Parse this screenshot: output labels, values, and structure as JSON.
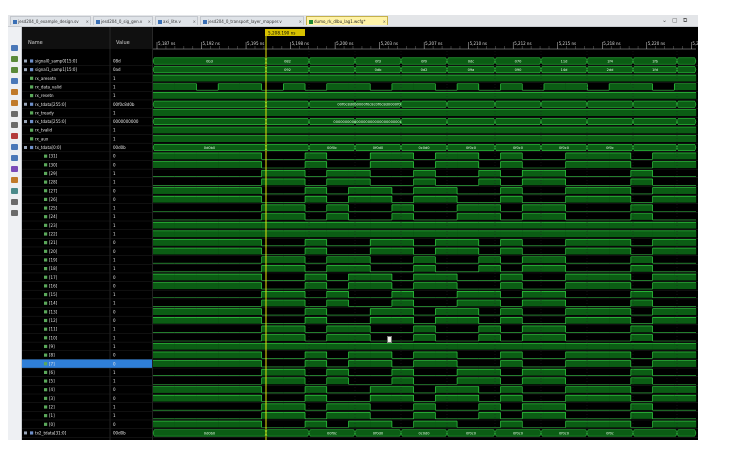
{
  "tabs": [
    {
      "label": "jesd204_0_example_design.sv"
    },
    {
      "label": "jesd204_0_sig_gen.v"
    },
    {
      "label": "axi_lite.v"
    },
    {
      "label": "jesd204_0_transport_layer_mapper.v"
    },
    {
      "label": "dumo_rk_dlbu_lag1.wcfg*",
      "active": true
    }
  ],
  "window_controls": {
    "menu": "⌄",
    "restore": "▢",
    "maximize": "⧉"
  },
  "columns": {
    "name": "Name",
    "value": "Value"
  },
  "cursor": {
    "label": "5,208.190 ns"
  },
  "timeline": {
    "ticks": [
      "5,187 ns",
      "5,192 ns",
      "5,195 ns",
      "5,198 ns",
      "5,200 ns",
      "5,203 ns",
      "5,207 ns",
      "5,210 ns",
      "5,212 ns",
      "5,215 ns",
      "5,218 ns",
      "5,220 ns",
      "5,222 ns"
    ]
  },
  "signals": [
    {
      "name": "signal0_samp0[15:0]",
      "value": "08d",
      "type": "bus",
      "segments": [
        "0b3",
        "082",
        "",
        "0f3",
        "0f0",
        "0dc",
        "070",
        "11d",
        "1f4",
        "1fb"
      ]
    },
    {
      "name": "signal1_samp1[15:0]",
      "value": "0ad",
      "type": "bus",
      "segments": [
        "",
        "092",
        "",
        "0db",
        "0d2",
        "09a",
        "090",
        "14d",
        "2dd",
        "1fd"
      ]
    },
    {
      "name": "rx_aresetn",
      "value": "1",
      "type": "high"
    },
    {
      "name": "rx_data_valid",
      "value": "1",
      "type": "bits",
      "pattern": "1101101011011010101101101"
    },
    {
      "name": "rx_resetn",
      "value": "1",
      "type": "high"
    },
    {
      "name": "rx_tdata[255:0]",
      "value": "00f0c8d0b",
      "type": "bus",
      "segments": [
        "",
        "",
        "",
        "00f0c8d0b0000f0c8c0f0c8d0000f0c8d0b000"
      ]
    },
    {
      "name": "rx_tready",
      "value": "1",
      "type": "high"
    },
    {
      "name": "rx_tdata[255:0]",
      "value": "0000000000",
      "type": "bus",
      "segments": [
        "",
        "",
        "",
        "000000000000000000000000000000000000000"
      ]
    },
    {
      "name": "rx_tvalid",
      "value": "1",
      "type": "high"
    },
    {
      "name": "rx_aux",
      "value": "1",
      "type": "high"
    },
    {
      "name": "tx_tdata[0:0]",
      "value": "00d0b",
      "type": "bus",
      "segments": [
        "0d0b0",
        "",
        "00f0c",
        "0f0d0",
        "0c0d0",
        "0f0c0",
        "0f0c0",
        "0f0c0",
        "0f0c"
      ]
    },
    {
      "name": "[31]",
      "value": "0",
      "type": "bits",
      "pattern": "1111100100110110100111011"
    },
    {
      "name": "[30]",
      "value": "0",
      "type": "bits",
      "pattern": "1111100100110110100111011"
    },
    {
      "name": "[29]",
      "value": "1",
      "type": "bits",
      "pattern": "0000011011001001011000100"
    },
    {
      "name": "[28]",
      "value": "1",
      "type": "bits",
      "pattern": "0000011011001001011000100"
    },
    {
      "name": "[27]",
      "value": "0",
      "type": "bits",
      "pattern": "1111100101101100100111011"
    },
    {
      "name": "[26]",
      "value": "0",
      "type": "bits",
      "pattern": "1111100101101100100111011"
    },
    {
      "name": "[25]",
      "value": "1",
      "type": "bits",
      "pattern": "0000011010010011011000100"
    },
    {
      "name": "[24]",
      "value": "1",
      "type": "bits",
      "pattern": "0000011010010011011000100"
    },
    {
      "name": "[23]",
      "value": "1",
      "type": "bits",
      "pattern": "1111111111111111111111111"
    },
    {
      "name": "[22]",
      "value": "1",
      "type": "bits",
      "pattern": "1111111111111111111111111"
    },
    {
      "name": "[21]",
      "value": "0",
      "type": "bits",
      "pattern": "1111100100110110100111011"
    },
    {
      "name": "[20]",
      "value": "0",
      "type": "bits",
      "pattern": "1111100100110110100111011"
    },
    {
      "name": "[19]",
      "value": "1",
      "type": "bits",
      "pattern": "0000011011001001011000100"
    },
    {
      "name": "[18]",
      "value": "1",
      "type": "bits",
      "pattern": "0000011011001001011000100"
    },
    {
      "name": "[17]",
      "value": "0",
      "type": "bits",
      "pattern": "1111100101101100100111011"
    },
    {
      "name": "[16]",
      "value": "0",
      "type": "bits",
      "pattern": "1111100101101100100111011"
    },
    {
      "name": "[15]",
      "value": "1",
      "type": "bits",
      "pattern": "0000011010010011011000100"
    },
    {
      "name": "[14]",
      "value": "1",
      "type": "bits",
      "pattern": "0000011010010011011000100"
    },
    {
      "name": "[13]",
      "value": "0",
      "type": "bits",
      "pattern": "1111100100110110100111011"
    },
    {
      "name": "[12]",
      "value": "0",
      "type": "bits",
      "pattern": "1111100100110110100111011"
    },
    {
      "name": "[11]",
      "value": "1",
      "type": "bits",
      "pattern": "0000011011001001011000100"
    },
    {
      "name": "[10]",
      "value": "1",
      "type": "bits",
      "pattern": "0000011011001001011000100"
    },
    {
      "name": "[9]",
      "value": "1",
      "type": "bits",
      "pattern": "1111111111111111111111111"
    },
    {
      "name": "[8]",
      "value": "0",
      "type": "bits",
      "pattern": "1111100101101100100111011"
    },
    {
      "name": "[7]",
      "value": "0",
      "type": "bits",
      "pattern": "1111100101101100100111011",
      "selected": true
    },
    {
      "name": "[6]",
      "value": "1",
      "type": "bits",
      "pattern": "0000011010010011011000100"
    },
    {
      "name": "[5]",
      "value": "1",
      "type": "bits",
      "pattern": "0000011010010011011000100"
    },
    {
      "name": "[4]",
      "value": "0",
      "type": "bits",
      "pattern": "1111100100110110100111011"
    },
    {
      "name": "[3]",
      "value": "0",
      "type": "bits",
      "pattern": "1111100100110110100111011"
    },
    {
      "name": "[2]",
      "value": "1",
      "type": "bits",
      "pattern": "0000011011001001011000100"
    },
    {
      "name": "[1]",
      "value": "1",
      "type": "bits",
      "pattern": "0000011011001001011000100"
    },
    {
      "name": "[0]",
      "value": "0",
      "type": "bits",
      "pattern": "1111100101101100100111011"
    },
    {
      "name": "tx2_tdata[31:0]",
      "value": "00d0b",
      "type": "bus",
      "segments": [
        "0d0b0",
        "",
        "00f0c",
        "0f0d0",
        "0c0d0",
        "0f0c0",
        "0f0c0",
        "0f0c0",
        "0f0c"
      ]
    }
  ],
  "tools": [
    {
      "name": "save-tool",
      "color": "#4a78b8"
    },
    {
      "name": "zoom-in-tool",
      "color": "#5a8a3a"
    },
    {
      "name": "zoom-out-tool",
      "color": "#5a8a3a"
    },
    {
      "name": "zoom-fit-tool",
      "color": "#4a78b8"
    },
    {
      "name": "go-to-start-tool",
      "color": "#c07a2a"
    },
    {
      "name": "go-to-end-tool",
      "color": "#c07a2a"
    },
    {
      "name": "prev-edge-tool",
      "color": "#6a6a6a"
    },
    {
      "name": "next-edge-tool",
      "color": "#6a6a6a"
    },
    {
      "name": "add-marker-tool",
      "color": "#b33b3b"
    },
    {
      "name": "prev-marker-tool",
      "color": "#4a78b8"
    },
    {
      "name": "next-marker-tool",
      "color": "#4a78b8"
    },
    {
      "name": "swap-cursor-tool",
      "color": "#7a4ab8"
    },
    {
      "name": "snap-tool",
      "color": "#c07a2a"
    },
    {
      "name": "group-tool",
      "color": "#4a8a8a"
    },
    {
      "name": "divider-tool",
      "color": "#6a6a6a"
    },
    {
      "name": "settings-tool",
      "color": "#6a6a6a"
    }
  ],
  "colors": {
    "wave_bg": "#000000",
    "bus_fill": "#0b5d14",
    "signal_line": "#38e24a",
    "low_line": "#3ac94a",
    "cursor": "#e4e40a",
    "cursor_label_bg": "#d8c200",
    "row_sep": "#202020",
    "grid": "#232323",
    "selected_row": "#2f7fd8",
    "name_text": "#e6e6e6",
    "header_text": "#d0d0d0"
  }
}
